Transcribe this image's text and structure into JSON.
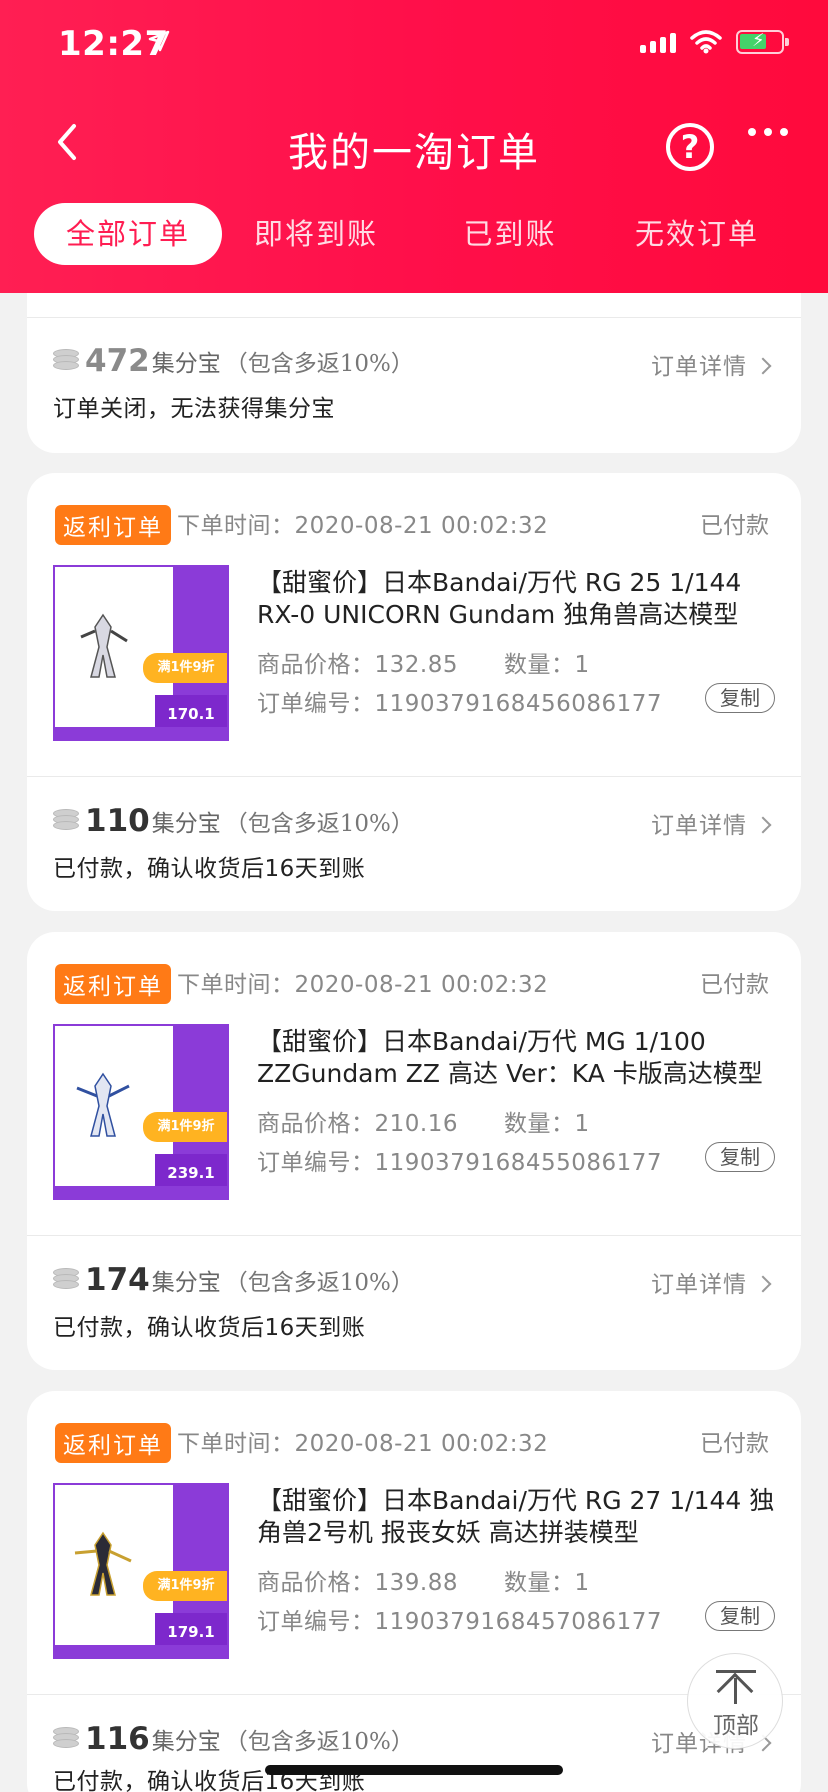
{
  "status_bar": {
    "time": "12:27"
  },
  "header": {
    "title": "我的一淘订单",
    "help_icon": "question-circle-icon",
    "more_icon": "more-dots-icon"
  },
  "tabs": [
    {
      "label": "全部订单",
      "active": true
    },
    {
      "label": "即将到账",
      "active": false
    },
    {
      "label": "已到账",
      "active": false
    },
    {
      "label": "无效订单",
      "active": false
    }
  ],
  "common": {
    "points_unit": "集分宝",
    "points_note": "（包含多返10%）",
    "detail_label": "订单详情",
    "badge": "返利订单",
    "time_label": "下单时间：",
    "price_label": "商品价格：",
    "qty_label": "数量：",
    "order_no_label": "订单编号：",
    "copy_label": "复制"
  },
  "partial_order": {
    "points": "472",
    "status_text": "订单关闭，无法获得集分宝"
  },
  "orders": [
    {
      "time": "2020-08-21 00:02:32",
      "status": "已付款",
      "title": "【甜蜜价】日本Bandai/万代 RG 25 1/144 RX-0 UNICORN Gundam 独角兽高达模型",
      "price": "132.85",
      "qty": "1",
      "order_no": "1190379168456086177",
      "thumb_price": "170.1",
      "points": "110",
      "status_text": "已付款，确认收货后16天到账"
    },
    {
      "time": "2020-08-21 00:02:32",
      "status": "已付款",
      "title": "【甜蜜价】日本Bandai/万代 MG 1/100 ZZGundam ZZ 高达 Ver：KA 卡版高达模型",
      "price": "210.16",
      "qty": "1",
      "order_no": "1190379168455086177",
      "thumb_price": "239.1",
      "points": "174",
      "status_text": "已付款，确认收货后16天到账"
    },
    {
      "time": "2020-08-21 00:02:32",
      "status": "已付款",
      "title": "【甜蜜价】日本Bandai/万代 RG 27 1/144 独角兽2号机 报丧女妖 高达拼装模型",
      "price": "139.88",
      "qty": "1",
      "order_no": "1190379168457086177",
      "thumb_price": "179.1",
      "points": "116",
      "status_text": "已付款，确认收货后16天到账"
    }
  ],
  "thumb_sale": "满1件9折",
  "to_top_label": "顶部",
  "colors": {
    "brand": "#ff1f53",
    "badge": "#ff7a16"
  }
}
